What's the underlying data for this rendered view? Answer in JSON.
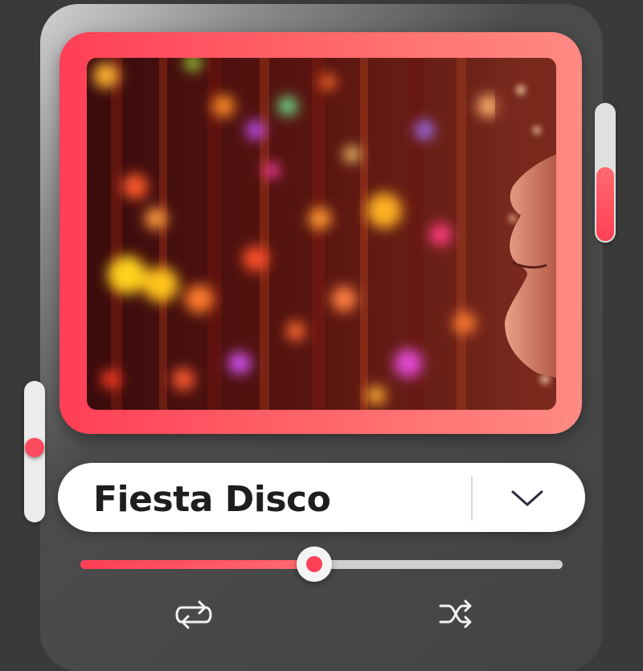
{
  "player": {
    "track_title": "Fiesta Disco",
    "progress_fraction": 0.485,
    "volume_right_fraction": 0.54,
    "volume_left_fraction": 0.53,
    "icons": {
      "dropdown": "chevron-down-icon",
      "repeat": "repeat-icon",
      "shuffle": "shuffle-icon"
    },
    "colors": {
      "accent": "#ff4157",
      "accent_light": "#ff8a84",
      "background": "#3a3a3a",
      "track": "#cfcfcf"
    }
  }
}
